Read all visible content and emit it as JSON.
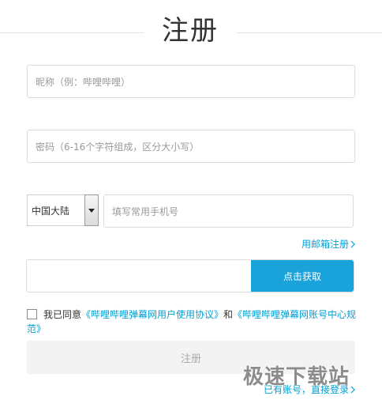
{
  "header": {
    "title": "注册"
  },
  "form": {
    "nickname_placeholder": "昵称（例：哔哩哔哩）",
    "password_placeholder": "密码（6-16个字符组成，区分大小写）",
    "region_value": "中国大陆",
    "phone_placeholder": "填写常用手机号",
    "email_register_label": "用邮箱注册",
    "get_code_label": "点击获取",
    "agreement": {
      "prefix": "我已同意",
      "link1": "《哔哩哔哩弹幕网用户使用协议》",
      "joiner": "和",
      "link2": "《哔哩哔哩弹幕网账号中心规范》",
      "checked": false
    },
    "submit_label": "注册",
    "login_label": "已有账号，直接登录"
  },
  "watermark": {
    "text": "极速下载站"
  },
  "colors": {
    "accent": "#00a1d6",
    "button_primary": "#1aa3db",
    "button_disabled": "#f3f3f3"
  },
  "icons": {
    "dropdown": "chevron-down-icon",
    "chevron": "chevron-right-icon"
  }
}
